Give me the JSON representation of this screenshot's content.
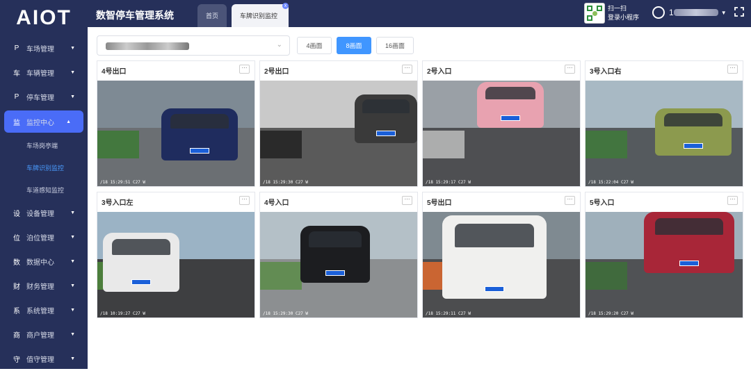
{
  "app": {
    "logo": "AIOT",
    "title": "数智停车管理系统"
  },
  "tabs": [
    {
      "label": "首页"
    },
    {
      "label": "车牌识别监控",
      "close": "x"
    }
  ],
  "header": {
    "qr_line1": "扫一扫",
    "qr_line2": "登录小程序",
    "user": "1",
    "fullscreen_icon": "fullscreen-icon"
  },
  "menu": [
    {
      "label": "车场管理",
      "icon": "P"
    },
    {
      "label": "车辆管理",
      "icon": "车"
    },
    {
      "label": "停车管理",
      "icon": "P"
    },
    {
      "label": "监控中心",
      "icon": "监"
    },
    {
      "label": "设备管理",
      "icon": "设"
    },
    {
      "label": "泊位管理",
      "icon": "位"
    },
    {
      "label": "数据中心",
      "icon": "数"
    },
    {
      "label": "财务管理",
      "icon": "财"
    },
    {
      "label": "系统管理",
      "icon": "系"
    },
    {
      "label": "商户管理",
      "icon": "商"
    },
    {
      "label": "值守管理",
      "icon": "守"
    }
  ],
  "submenu": [
    {
      "label": "车场岗亭端"
    },
    {
      "label": "车牌识别监控"
    },
    {
      "label": "车道感知监控"
    }
  ],
  "toolbar": {
    "select_value": "",
    "view4": "4画面",
    "view8": "8画面",
    "view16": "16画面",
    "selected_view": "8画面"
  },
  "cameras": [
    {
      "name": "4号出口",
      "ts": "/18 15:29:51  C27 W"
    },
    {
      "name": "2号出口",
      "ts": "/18 15:29:30  C27 W"
    },
    {
      "name": "2号入口",
      "ts": "/18 15:29:17  C27 W"
    },
    {
      "name": "3号入口右",
      "ts": "/18 15:22:04  C27 W"
    },
    {
      "name": "3号入口左",
      "ts": "/18 10:19:27  C27 W"
    },
    {
      "name": "4号入口",
      "ts": "/18 15:29:30  C27 W"
    },
    {
      "name": "5号出口",
      "ts": "/18 15:29:11  C27 W"
    },
    {
      "name": "5号入口",
      "ts": "/18 15:29:20  C27 W"
    }
  ],
  "colors": {
    "sidebar": "#26305a",
    "accent": "#4a6cf7",
    "button_active": "#4096ff"
  }
}
